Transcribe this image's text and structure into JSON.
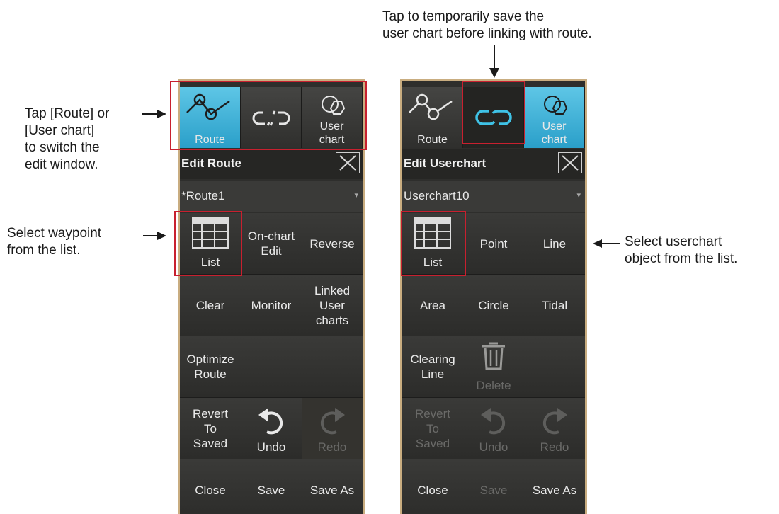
{
  "annotations": {
    "top": "Tap to temporarily save the\nuser chart before linking with route.",
    "left_tabs": "Tap [Route] or\n[User chart]\nto switch the\nedit window.",
    "left_list": "Select waypoint\nfrom the list.",
    "right_list": "Select userchart\nobject from the list."
  },
  "left_panel": {
    "tabs": {
      "route": "Route",
      "link": "",
      "user_chart": "User\nchart"
    },
    "header": "Edit Route",
    "selector": "*Route1",
    "buttons": {
      "list": "List",
      "onchart": "On-chart\nEdit",
      "reverse": "Reverse",
      "clear": "Clear",
      "monitor": "Monitor",
      "linked": "Linked\nUser\ncharts",
      "optimize": "Optimize\nRoute",
      "revert": "Revert\nTo\nSaved",
      "undo": "Undo",
      "redo": "Redo",
      "close": "Close",
      "save": "Save",
      "save_as": "Save As"
    }
  },
  "right_panel": {
    "tabs": {
      "route": "Route",
      "user_chart": "User\nchart"
    },
    "header": "Edit Userchart",
    "selector": "Userchart10",
    "buttons": {
      "list": "List",
      "point": "Point",
      "line": "Line",
      "area": "Area",
      "circle": "Circle",
      "tidal": "Tidal",
      "clearing": "Clearing\nLine",
      "delete": "Delete",
      "revert": "Revert\nTo\nSaved",
      "undo": "Undo",
      "redo": "Redo",
      "close": "Close",
      "save": "Save",
      "save_as": "Save As"
    }
  },
  "colors": {
    "accent": "#2a9fc9",
    "highlight_box": "#c8202f",
    "panel_bg": "#2e2e2c"
  }
}
